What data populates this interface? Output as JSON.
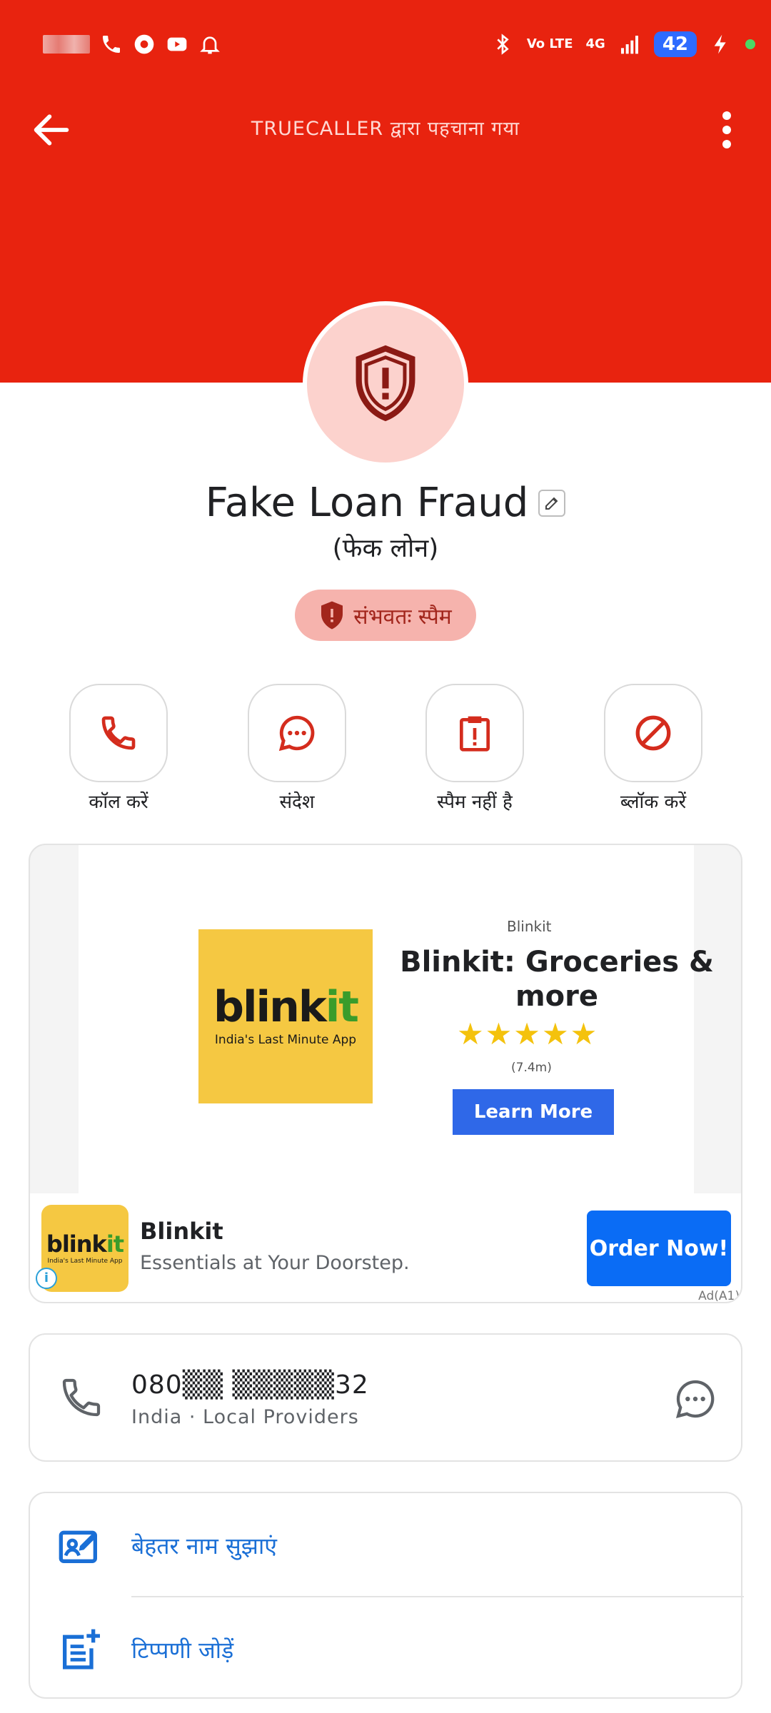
{
  "header": {
    "title": "TRUECALLER द्वारा पहचाना गया",
    "background_color": "#e8230f"
  },
  "status_bar": {
    "network_labels": [
      "Vo LTE",
      "4G"
    ],
    "battery": "42"
  },
  "contact": {
    "name": "Fake Loan Fraud",
    "subname": "(फेक लोन)",
    "badge": "संभवतः स्पैम",
    "avatar_icon": "shield-exclamation-icon"
  },
  "actions": [
    {
      "label": "कॉल करें",
      "icon": "phone-icon"
    },
    {
      "label": "संदेश",
      "icon": "chat-bubble-icon"
    },
    {
      "label": "स्पैम नहीं है",
      "icon": "not-spam-icon"
    },
    {
      "label": "ब्लॉक करें",
      "icon": "block-icon"
    }
  ],
  "ad": {
    "logo_word_a": "blink",
    "logo_word_b": "it",
    "logo_tagline": "India's Last Minute App",
    "brand_small": "Blinkit",
    "headline": "Blinkit: Groceries & more",
    "stars": "★★★★★",
    "rating": 4.5,
    "rating_count": "(7.4m)",
    "cta": "Learn More",
    "app_name": "Blinkit",
    "app_desc": "Essentials at Your Doorstep.",
    "order_button": "Order Now!",
    "info_glyph": "i",
    "ad_choice": "Ad(A1)"
  },
  "phone": {
    "number": "080▒▒ ▒▒▒▒▒32",
    "meta": "India · Local Providers"
  },
  "options": [
    {
      "label": "बेहतर नाम सुझाएं",
      "icon": "suggest-name-icon"
    },
    {
      "label": "टिप्पणी जोड़ें",
      "icon": "add-note-icon"
    }
  ],
  "colors": {
    "accent_red": "#e8230f",
    "link_blue": "#1a6fd6",
    "cta_blue": "#0a6cf5"
  }
}
